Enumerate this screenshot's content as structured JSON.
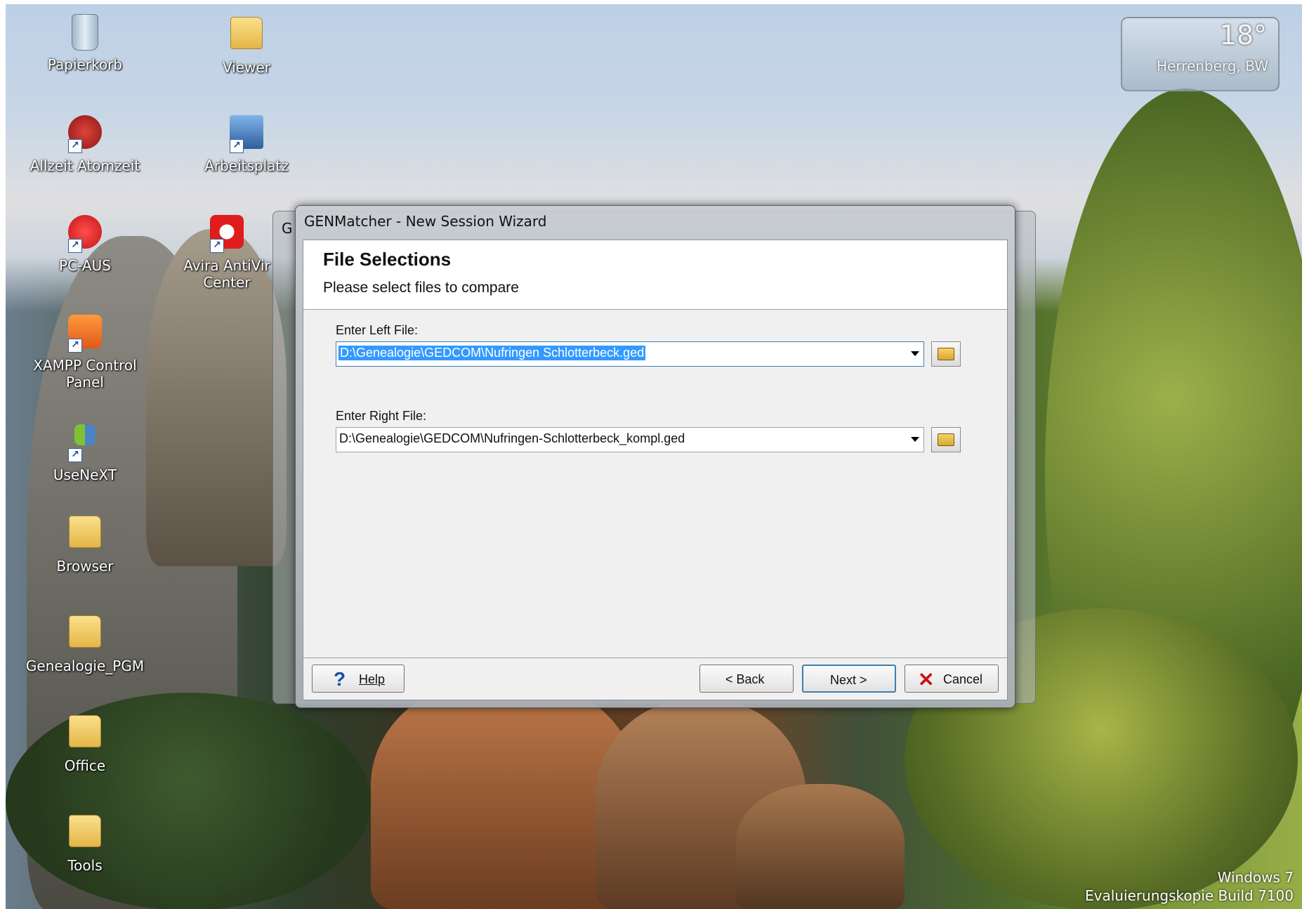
{
  "desktop": {
    "icons": [
      {
        "label": "Papierkorb"
      },
      {
        "label": "Viewer"
      },
      {
        "label": "Allzeit Atomzeit"
      },
      {
        "label": "Arbeitsplatz"
      },
      {
        "label": "PC-AUS"
      },
      {
        "label": "Avira AntiVir Center"
      },
      {
        "label": "XAMPP Control Panel"
      },
      {
        "label": "UseNeXT"
      },
      {
        "label": "Browser"
      },
      {
        "label": "Genealogie_PGM"
      },
      {
        "label": "Office"
      },
      {
        "label": "Tools"
      }
    ],
    "weather": {
      "temp": "18°",
      "city": "Herrenberg, BW"
    },
    "watermark": {
      "line1": "Windows 7",
      "line2": "Evaluierungskopie Build 7100"
    }
  },
  "background_window": {
    "title_char": "G"
  },
  "dialog": {
    "title": "GENMatcher - New Session Wizard",
    "header_title": "File Selections",
    "header_subtitle": "Please select files to compare",
    "left_label": "Enter Left File:",
    "left_value": "D:\\Genealogie\\GEDCOM\\Nufringen Schlotterbeck.ged",
    "right_label": "Enter Right File:",
    "right_value": "D:\\Genealogie\\GEDCOM\\Nufringen-Schlotterbeck_kompl.ged",
    "buttons": {
      "help": "Help",
      "back": "< Back",
      "next": "Next >",
      "cancel": "Cancel"
    },
    "colors": {
      "selection": "#3399ff",
      "help_icon": "#1a4fa8",
      "cancel_icon": "#cc1111"
    }
  }
}
